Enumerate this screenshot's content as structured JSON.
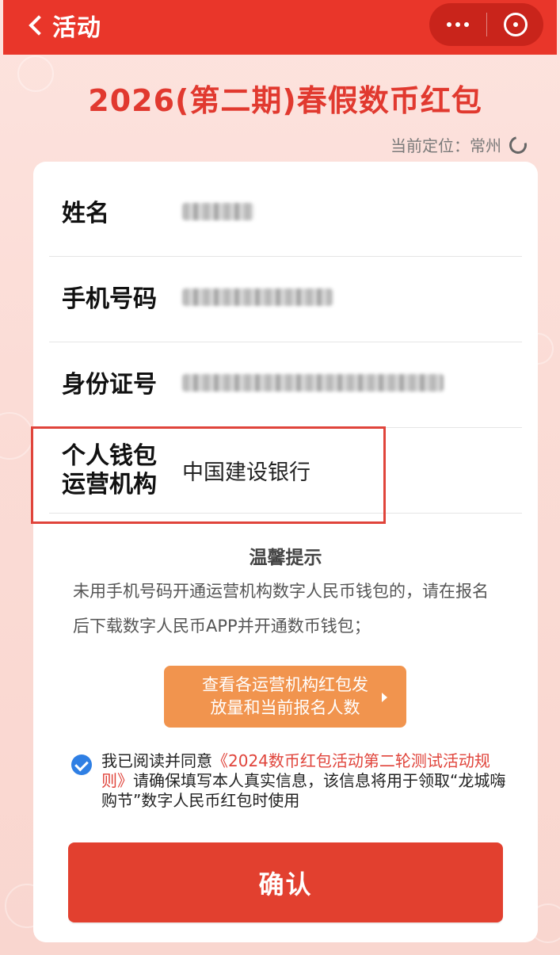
{
  "nav": {
    "back_label": "活动",
    "more_icon": "more-dots-icon",
    "close_icon": "close-target-icon"
  },
  "headline": "2026(第二期)春假数币红包",
  "location": {
    "label": "当前定位：",
    "city": "常州",
    "refresh_icon": "refresh-icon"
  },
  "form": {
    "name_label": "姓名",
    "phone_label": "手机号码",
    "id_label": "身份证号",
    "wallet_label": "个人钱包运营机构",
    "wallet_value": "中国建设银行"
  },
  "tips": {
    "title": "温馨提示",
    "text": "未用手机号码开通运营机构数字人民币钱包的，请在报名后下载数字人民币APP并开通数币钱包；"
  },
  "stats_button": {
    "label": "查看各运营机构红包发放量和当前报名人数"
  },
  "agreement": {
    "prefix": "我已阅读并同意",
    "link": "《2024数币红包活动第二轮测试活动规则》",
    "suffix": "请确保填写本人真实信息，该信息将用于领取“龙城嗨购节”数字人民币红包时使用",
    "checked": true
  },
  "confirm_button": {
    "label": "确认"
  },
  "colors": {
    "brand_red": "#e9362a",
    "headline_red": "#e1392f",
    "orange": "#f1944e",
    "check_blue": "#2f7fe4"
  }
}
